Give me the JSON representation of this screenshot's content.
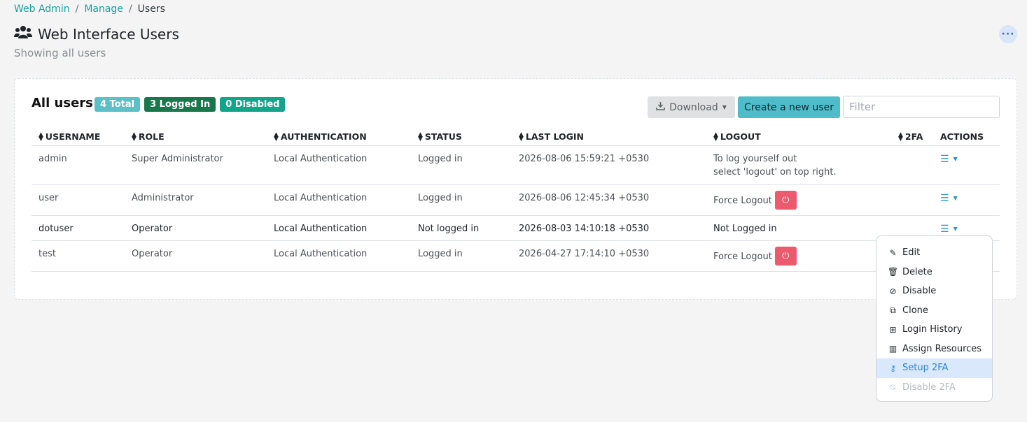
{
  "breadcrumb": {
    "items": [
      "Web Admin",
      "Manage"
    ],
    "separator": "/",
    "current": "Users"
  },
  "page": {
    "title": "Web Interface Users",
    "subtitle": "Showing all users",
    "title_icon": "users-icon",
    "more_icon": "ellipsis-icon"
  },
  "card": {
    "title": "All users",
    "badges": {
      "total": "4 Total",
      "logged_in": "3 Logged In",
      "disabled": "0 Disabled"
    },
    "download_label": "Download",
    "create_label": "Create a new user",
    "filter_placeholder": "Filter"
  },
  "table": {
    "headers": [
      "USERNAME",
      "ROLE",
      "AUTHENTICATION",
      "STATUS",
      "LAST LOGIN",
      "LOGOUT",
      "2FA",
      "ACTIONS"
    ],
    "rows": [
      {
        "username": "admin",
        "role": "Super Administrator",
        "auth": "Local Authentication",
        "status": "Logged in",
        "last_login": "2026-08-06 15:59:21 +0530",
        "logout_line1": "To log yourself out",
        "logout_line2": "select 'logout' on top right."
      },
      {
        "username": "user",
        "role": "Administrator",
        "auth": "Local Authentication",
        "status": "Logged in",
        "last_login": "2026-08-06 12:45:34 +0530",
        "logout": "Force Logout"
      },
      {
        "username": "dotuser",
        "role": "Operator",
        "auth": "Local Authentication",
        "status": "Not logged in",
        "last_login": "2026-08-03 14:10:18 +0530",
        "logout": "Not Logged in"
      },
      {
        "username": "test",
        "role": "Operator",
        "auth": "Local Authentication",
        "status": "Logged in",
        "last_login": "2026-04-27 17:14:10 +0530",
        "logout": "Force Logout"
      }
    ]
  },
  "menu": {
    "items": [
      {
        "label": "Edit",
        "icon": "pencil-icon"
      },
      {
        "label": "Delete",
        "icon": "trash-icon"
      },
      {
        "label": "Disable",
        "icon": "ban-icon"
      },
      {
        "label": "Clone",
        "icon": "copy-icon"
      },
      {
        "label": "Login History",
        "icon": "table-icon"
      },
      {
        "label": "Assign Resources",
        "icon": "barcode-icon"
      },
      {
        "label": "Setup 2FA",
        "icon": "key-icon"
      },
      {
        "label": "Disable 2FA",
        "icon": "user-slash-icon"
      }
    ]
  },
  "colors": {
    "accent": "#17a2a0",
    "create_button": "#4fbcc9",
    "danger": "#ec5a6d",
    "link_blue": "#2b95cf"
  }
}
